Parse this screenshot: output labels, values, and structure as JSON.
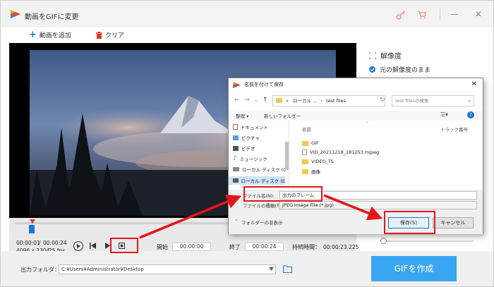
{
  "app": {
    "title": "動画をGIFに変更",
    "add_video": "動画を追加",
    "clear": "クリア"
  },
  "right_panel": {
    "resolution_label": "解像度",
    "keep_resolution": "元の解像度のまま"
  },
  "player": {
    "current_time": "00:00:01",
    "total_time": "00:00:24",
    "resolution_text": "4096 x 2304",
    "fps_text": "25 fps",
    "start_label": "開始",
    "start_value": "00:00:00",
    "end_label": "終了",
    "end_value": "00:00:24",
    "duration_label": "持続時間：",
    "duration_value": "00:00:23.225"
  },
  "bottom": {
    "output_label": "出力フォルダ：",
    "output_path": "C:¥Users¥Administrator¥Desktop",
    "create_gif": "GIFを作成"
  },
  "dialog": {
    "title": "名前を付けて保存",
    "address_prefix": "«",
    "address_part1": "ローカル ...",
    "address_part2": "test files",
    "search_placeholder": "test filesの検索",
    "organize": "整理 ▾",
    "new_folder": "新しいフォルダー",
    "col_name": "名前",
    "col_track": "トラック番号",
    "tree": [
      {
        "label": "ドキュメント"
      },
      {
        "label": "ピクチャ"
      },
      {
        "label": "ビデオ"
      },
      {
        "label": "ミュージック"
      },
      {
        "label": "ローカル ディスク (C"
      },
      {
        "label": "ローカル ディスク (E"
      }
    ],
    "files": [
      {
        "label": "GIF"
      },
      {
        "label": "VID_20211218_181253.mjpeg"
      },
      {
        "label": "VIDEO_TS"
      },
      {
        "label": "画像"
      }
    ],
    "filename_label": "ファイル名(N):",
    "filename_value": "出力のフレーム",
    "filetype_label": "ファイルの種類(T):",
    "filetype_value": "JPEG Image File (*.jpg)",
    "hide_folders": "フォルダーの非表示",
    "save": "保存(S)",
    "cancel": "キャンセル"
  },
  "colors": {
    "accent": "#39a6f2",
    "highlight": "#e2161b",
    "timeline_marker": "#d23a2a",
    "handle": "#1b76d6"
  }
}
